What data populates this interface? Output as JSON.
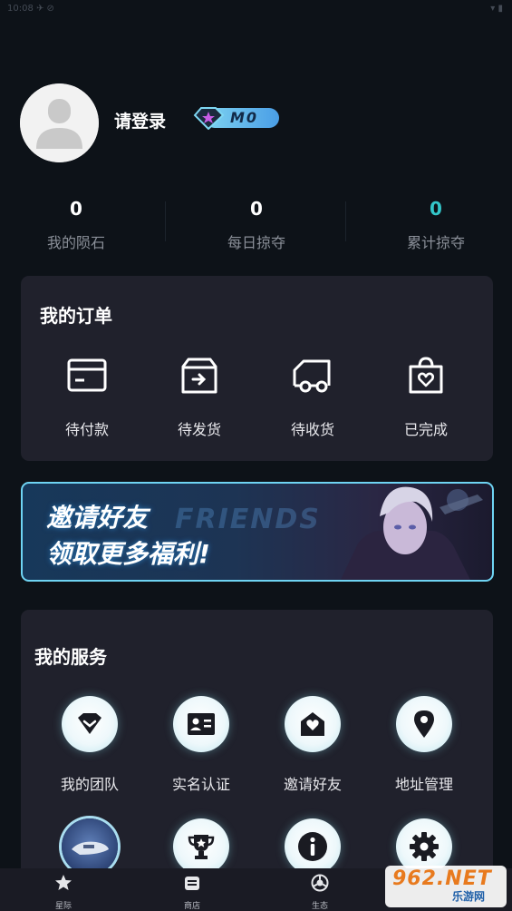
{
  "status_bar": {
    "left": "10:08 ✈ ⊘",
    "right": "▾ ▮"
  },
  "profile": {
    "login_label": "请登录",
    "level": "M0"
  },
  "stats": [
    {
      "value": "0",
      "label": "我的陨石"
    },
    {
      "value": "0",
      "label": "每日掠夺"
    },
    {
      "value": "0",
      "label": "累计掠夺"
    }
  ],
  "orders": {
    "title": "我的订单",
    "items": [
      {
        "label": "待付款",
        "icon": "card-icon"
      },
      {
        "label": "待发货",
        "icon": "box-icon"
      },
      {
        "label": "待收货",
        "icon": "truck-icon"
      },
      {
        "label": "已完成",
        "icon": "bag-heart-icon"
      }
    ]
  },
  "banner": {
    "line1": "邀请好友",
    "line2": "领取更多福利!",
    "ghost": "FRIENDS"
  },
  "services": {
    "title": "我的服务",
    "items": [
      {
        "label": "我的团队",
        "icon": "team-diamond-icon"
      },
      {
        "label": "实名认证",
        "icon": "id-card-icon"
      },
      {
        "label": "邀请好友",
        "icon": "invite-heart-icon"
      },
      {
        "label": "地址管理",
        "icon": "location-pin-icon"
      },
      {
        "label": "",
        "icon": "spaceship-icon"
      },
      {
        "label": "",
        "icon": "trophy-icon"
      },
      {
        "label": "",
        "icon": "info-icon"
      },
      {
        "label": "",
        "icon": "settings-gear-icon"
      }
    ]
  },
  "tabbar": [
    {
      "label": "星际",
      "icon": "star-icon"
    },
    {
      "label": "商店",
      "icon": "store-icon"
    },
    {
      "label": "生态",
      "icon": "ecology-icon"
    }
  ],
  "watermark": {
    "big": "962.NET",
    "small": "乐游网"
  },
  "colors": {
    "background": "#0d1218",
    "card": "#20212c",
    "accent_teal": "#33c6c9",
    "banner_border": "#6fd4f3"
  }
}
